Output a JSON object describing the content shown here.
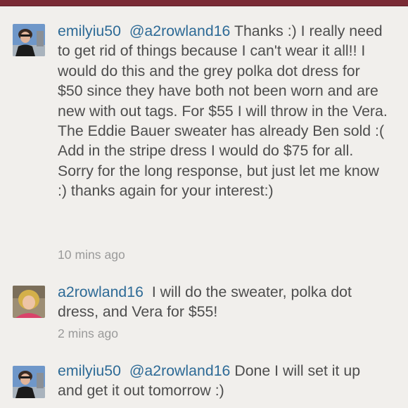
{
  "comments": [
    {
      "username": "emilyiu50",
      "mention": "@a2rowland16",
      "text": "Thanks :) I really need to get rid of things because I can't wear it all!!  I would do this and the grey polka dot dress for $50 since they have both not been worn and are new with out tags. For $55 I will throw in the Vera. The Eddie Bauer sweater has already Ben sold :( Add in the stripe dress I would do $75 for all. Sorry for the long response, but just let me know :) thanks again for your interest:)",
      "timestamp": "10 mins ago"
    },
    {
      "username": "a2rowland16",
      "mention": "",
      "text": "I will do the sweater, polka dot dress, and Vera for $55!",
      "timestamp": "2 mins ago"
    },
    {
      "username": "emilyiu50",
      "mention": "@a2rowland16",
      "text": "Done I will set it up and get it out tomorrow :)",
      "timestamp": ""
    }
  ],
  "colors": {
    "username": "#2d6a96",
    "body_text": "#4d4d4d",
    "timestamp": "#9a9a9a",
    "background": "#f1efec",
    "top_bar": "#7a2b35"
  }
}
